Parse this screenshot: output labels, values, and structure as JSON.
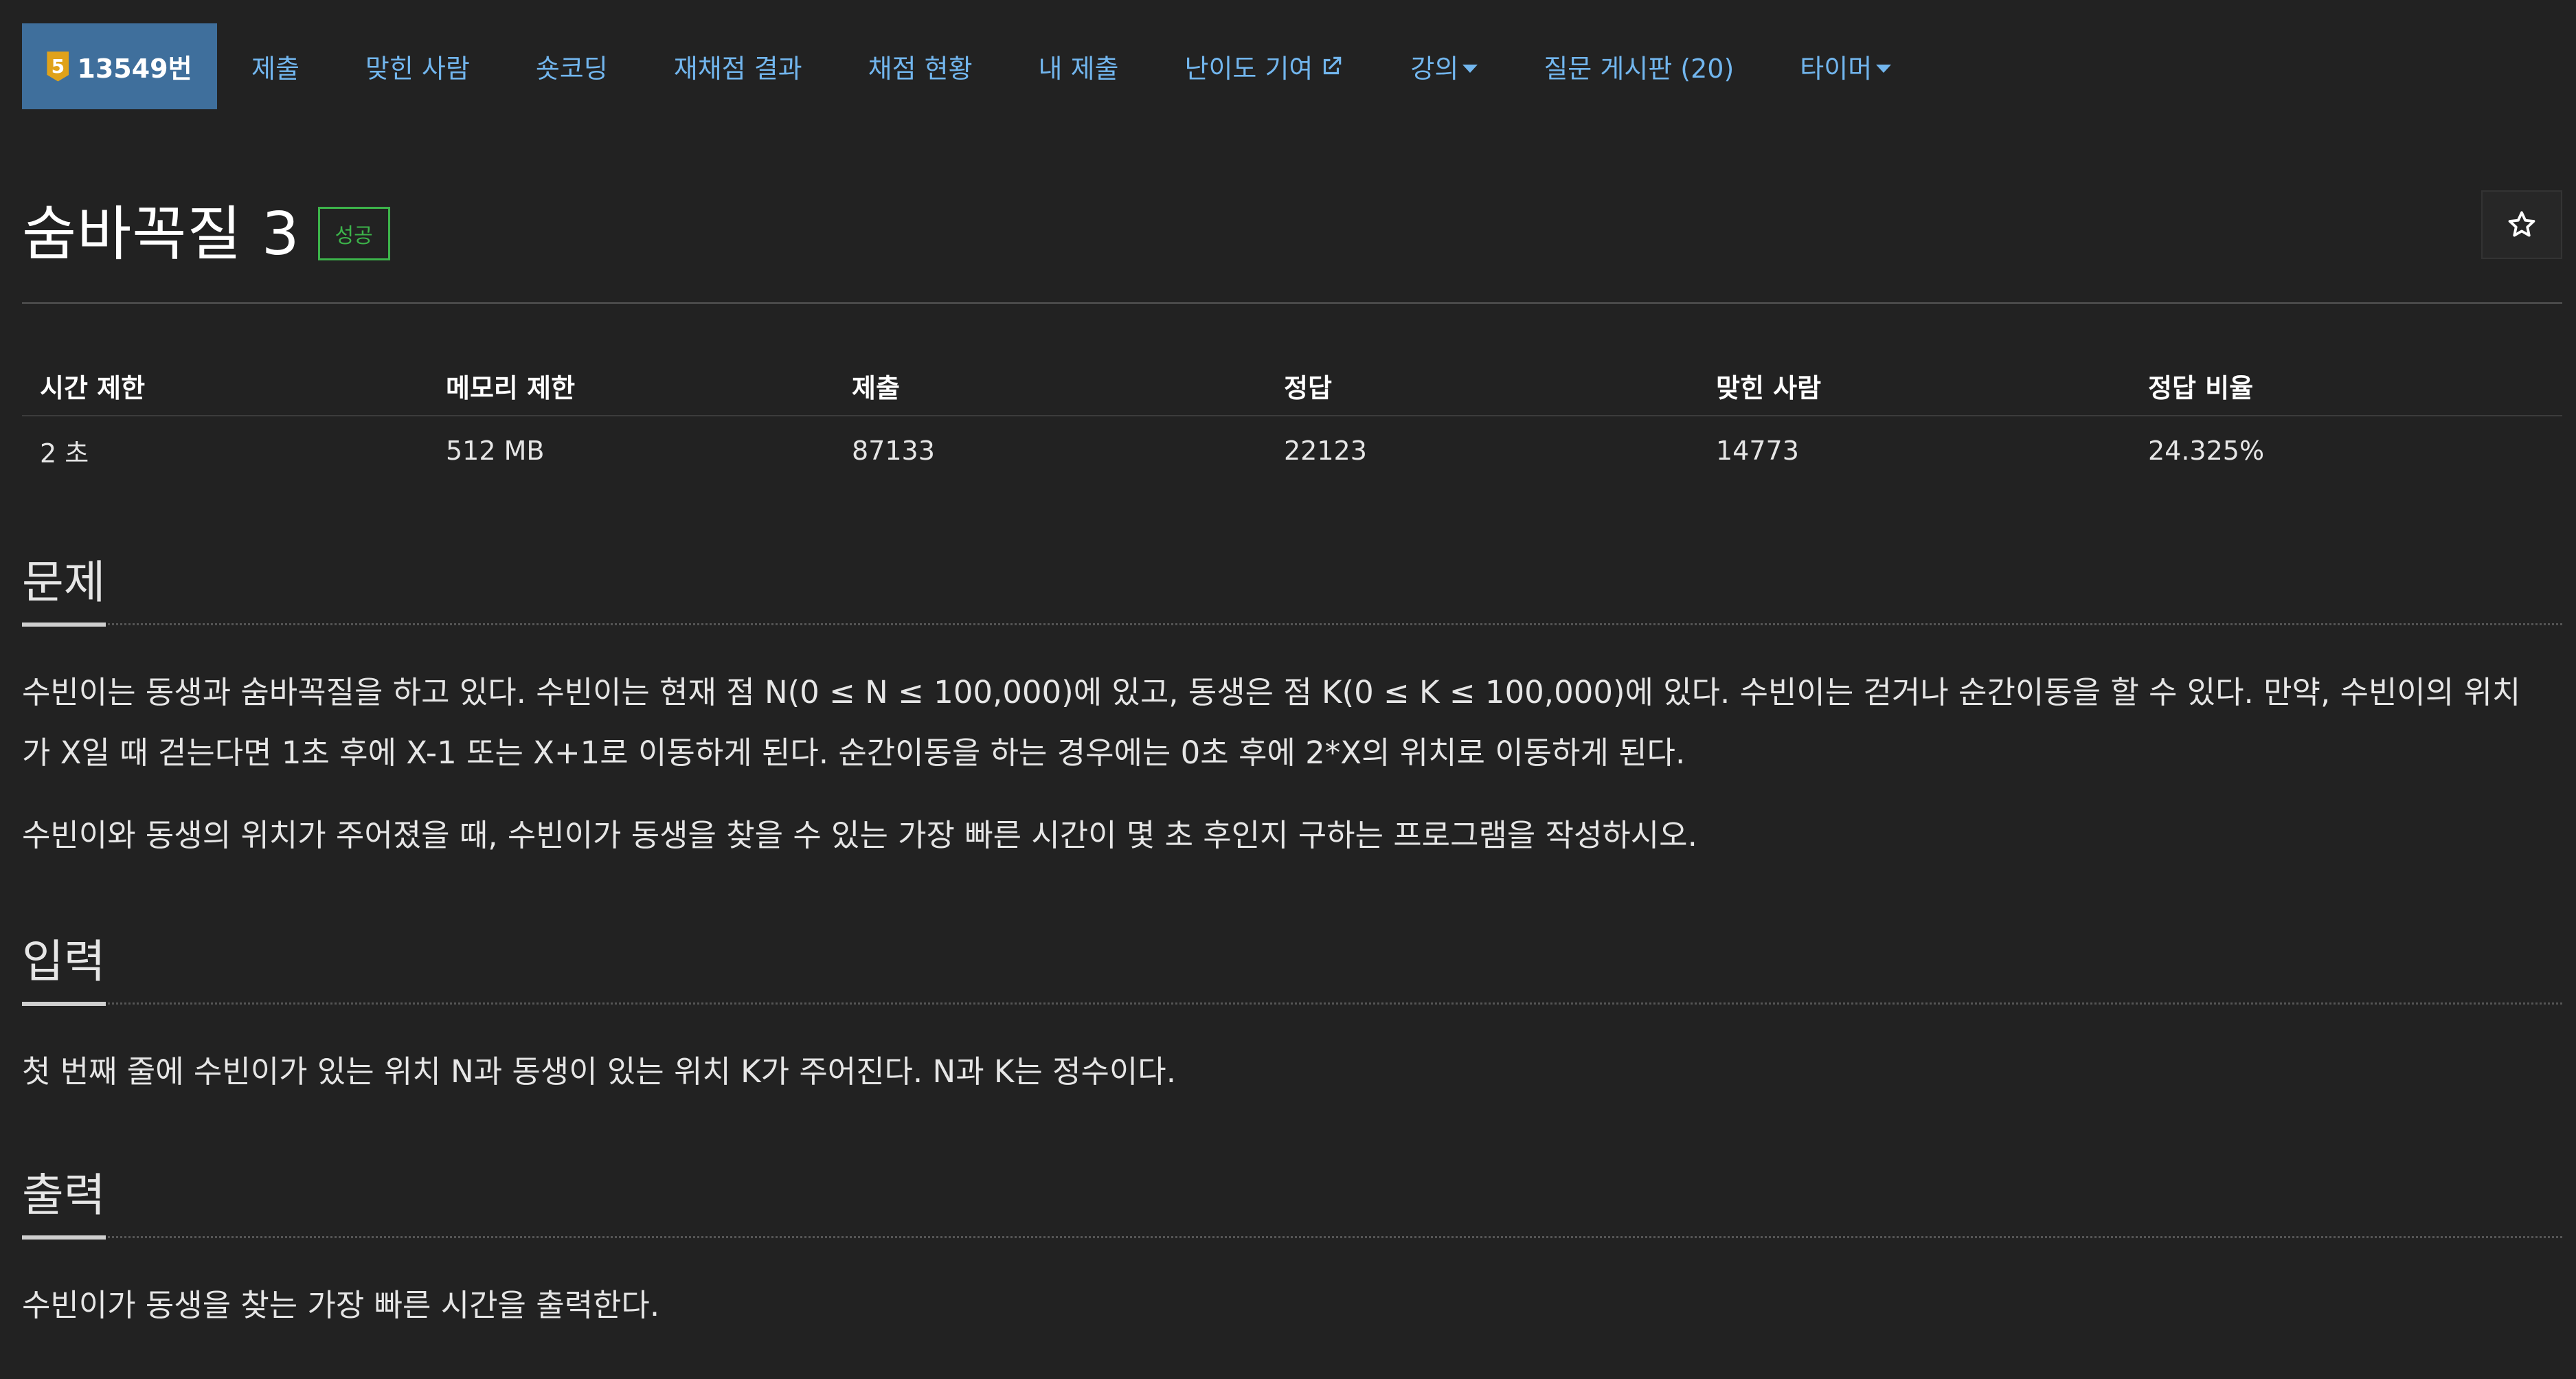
{
  "nav": {
    "brand": {
      "badge": "5",
      "label": "13549번"
    },
    "items": [
      "제출",
      "맞힌 사람",
      "숏코딩",
      "재채점 결과",
      "채점 현황",
      "내 제출",
      "난이도 기여",
      "강의",
      "질문 게시판 (20)",
      "타이머"
    ]
  },
  "problem": {
    "title": "숨바꼭질 3",
    "result_label": "성공",
    "result_color": "#3cb44a"
  },
  "info_table": {
    "headers": [
      "시간 제한",
      "메모리 제한",
      "제출",
      "정답",
      "맞힌 사람",
      "정답 비율"
    ],
    "values": [
      "2 초",
      "512 MB",
      "87133",
      "22123",
      "14773",
      "24.325%"
    ]
  },
  "sections": {
    "description": {
      "title": "문제",
      "line1": "수빈이는 동생과 숨바꼭질을 하고 있다. 수빈이는 현재 점 N(0 ≤ N ≤ 100,000)에 있고, 동생은 점 K(0 ≤ K ≤ 100,000)에 있다. 수빈이는 걷거나 순간이동을 할 수 있다. 만약, 수빈이의 위치",
      "line2": "가 X일 때 걷는다면 1초 후에 X-1 또는 X+1로 이동하게 된다. 순간이동을 하는 경우에는 0초 후에 2*X의 위치로 이동하게 된다.",
      "line3": "수빈이와 동생의 위치가 주어졌을 때, 수빈이가 동생을 찾을 수 있는 가장 빠른 시간이 몇 초 후인지 구하는 프로그램을 작성하시오."
    },
    "input": {
      "title": "입력",
      "text": "첫 번째 줄에 수빈이가 있는 위치 N과 동생이 있는 위치 K가 주어진다. N과 K는 정수이다."
    },
    "output": {
      "title": "출력",
      "text": "수빈이가 동생을 찾는 가장 빠른 시간을 출력한다."
    }
  },
  "icons": {
    "star": "star-icon",
    "external_link": "external-link-icon",
    "dropdown": "caret-down-icon"
  },
  "colors": {
    "link": "#72b6ee",
    "brand_bg": "#3f6f9c",
    "tier": "#e0a21a",
    "background": "#222222"
  }
}
